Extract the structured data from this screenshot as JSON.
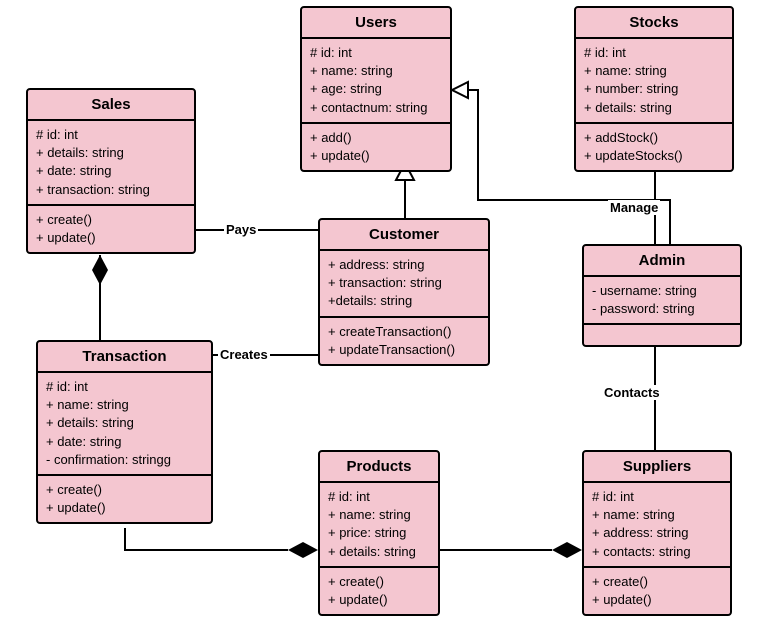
{
  "classes": {
    "users": {
      "name": "Users",
      "attrs": [
        "# id: int",
        "+ name: string",
        "+ age: string",
        "+ contactnum: string"
      ],
      "ops": [
        "+ add()",
        "+ update()"
      ]
    },
    "stocks": {
      "name": "Stocks",
      "attrs": [
        "# id: int",
        "+ name: string",
        "+ number: string",
        "+ details: string"
      ],
      "ops": [
        "+ addStock()",
        "+ updateStocks()"
      ]
    },
    "sales": {
      "name": "Sales",
      "attrs": [
        "# id: int",
        "+ details: string",
        "+ date: string",
        "+ transaction: string"
      ],
      "ops": [
        "+ create()",
        "+ update()"
      ]
    },
    "customer": {
      "name": "Customer",
      "attrs": [
        "+ address: string",
        "+ transaction: string",
        "+details: string"
      ],
      "ops": [
        "+ createTransaction()",
        "+ updateTransaction()"
      ]
    },
    "admin": {
      "name": "Admin",
      "attrs": [
        "- username: string",
        "- password: string"
      ],
      "ops": []
    },
    "transaction": {
      "name": "Transaction",
      "attrs": [
        "# id: int",
        "+ name: string",
        "+ details: string",
        "+ date: string",
        "- confirmation: stringg"
      ],
      "ops": [
        "+ create()",
        "+ update()"
      ]
    },
    "products": {
      "name": "Products",
      "attrs": [
        "# id: int",
        "+ name: string",
        "+ price: string",
        "+ details: string"
      ],
      "ops": [
        "+ create()",
        "+ update()"
      ]
    },
    "suppliers": {
      "name": "Suppliers",
      "attrs": [
        "# id: int",
        "+ name: string",
        "+ address: string",
        "+ contacts: string"
      ],
      "ops": [
        "+ create()",
        "+ update()"
      ]
    }
  },
  "relations": {
    "pays": "Pays",
    "creates": "Creates",
    "manage": "Manage",
    "contacts": "Contacts"
  },
  "chart_data": {
    "type": "uml-class-diagram",
    "classes": [
      {
        "name": "Users",
        "attributes": [
          "# id: int",
          "+ name: string",
          "+ age: string",
          "+ contactnum: string"
        ],
        "operations": [
          "+ add()",
          "+ update()"
        ]
      },
      {
        "name": "Stocks",
        "attributes": [
          "# id: int",
          "+ name: string",
          "+ number: string",
          "+ details: string"
        ],
        "operations": [
          "+ addStock()",
          "+ updateStocks()"
        ]
      },
      {
        "name": "Sales",
        "attributes": [
          "# id: int",
          "+ details: string",
          "+ date: string",
          "+ transaction: string"
        ],
        "operations": [
          "+ create()",
          "+ update()"
        ]
      },
      {
        "name": "Customer",
        "attributes": [
          "+ address: string",
          "+ transaction: string",
          "+details: string"
        ],
        "operations": [
          "+ createTransaction()",
          "+ updateTransaction()"
        ]
      },
      {
        "name": "Admin",
        "attributes": [
          "- username: string",
          "- password: string"
        ],
        "operations": []
      },
      {
        "name": "Transaction",
        "attributes": [
          "# id: int",
          "+ name: string",
          "+ details: string",
          "+ date: string",
          "- confirmation: stringg"
        ],
        "operations": [
          "+ create()",
          "+ update()"
        ]
      },
      {
        "name": "Products",
        "attributes": [
          "# id: int",
          "+ name: string",
          "+ price: string",
          "+ details: string"
        ],
        "operations": [
          "+ create()",
          "+ update()"
        ]
      },
      {
        "name": "Suppliers",
        "attributes": [
          "# id: int",
          "+ name: string",
          "+ address: string",
          "+ contacts: string"
        ],
        "operations": [
          "+ create()",
          "+ update()"
        ]
      }
    ],
    "relationships": [
      {
        "from": "Customer",
        "to": "Users",
        "type": "generalization"
      },
      {
        "from": "Admin",
        "to": "Users",
        "type": "generalization"
      },
      {
        "from": "Sales",
        "to": "Customer",
        "type": "association",
        "label": "Pays"
      },
      {
        "from": "Transaction",
        "to": "Customer",
        "type": "association",
        "label": "Creates"
      },
      {
        "from": "Admin",
        "to": "Stocks",
        "type": "association",
        "label": "Manage"
      },
      {
        "from": "Admin",
        "to": "Suppliers",
        "type": "association",
        "label": "Contacts"
      },
      {
        "from": "Sales",
        "to": "Transaction",
        "type": "composition",
        "diamond_at": "Sales"
      },
      {
        "from": "Transaction",
        "to": "Products",
        "type": "composition",
        "diamond_at": "Products"
      },
      {
        "from": "Products",
        "to": "Suppliers",
        "type": "composition",
        "diamond_at": "Suppliers"
      }
    ]
  }
}
